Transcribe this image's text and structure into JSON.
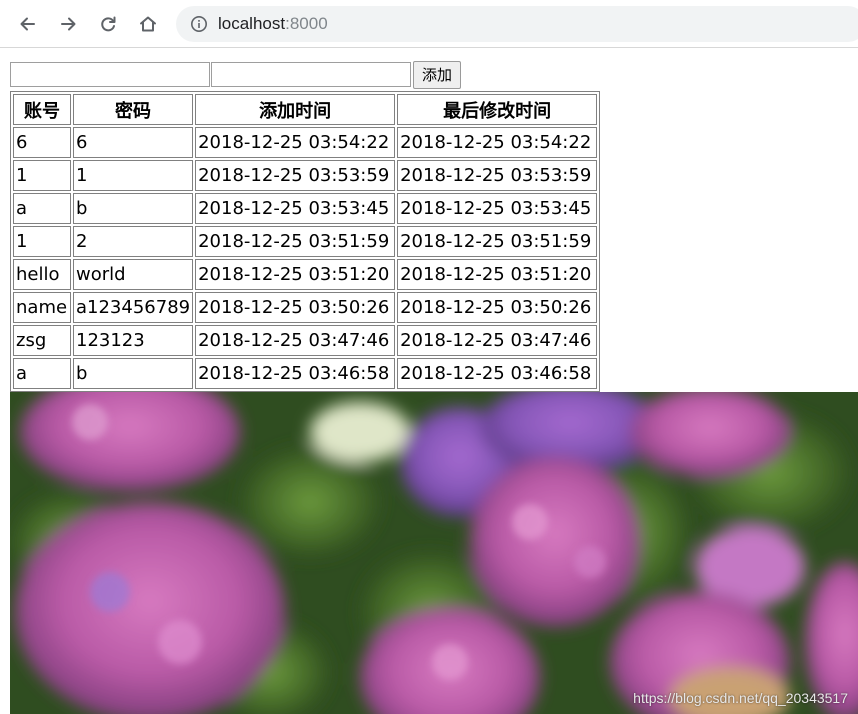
{
  "browser": {
    "url_host": "localhost",
    "url_port": ":8000"
  },
  "form": {
    "add_button": "添加"
  },
  "table": {
    "headers": [
      "账号",
      "密码",
      "添加时间",
      "最后修改时间"
    ],
    "rows": [
      [
        "6",
        "6",
        "2018-12-25 03:54:22",
        "2018-12-25 03:54:22"
      ],
      [
        "1",
        "1",
        "2018-12-25 03:53:59",
        "2018-12-25 03:53:59"
      ],
      [
        "a",
        "b",
        "2018-12-25 03:53:45",
        "2018-12-25 03:53:45"
      ],
      [
        "1",
        "2",
        "2018-12-25 03:51:59",
        "2018-12-25 03:51:59"
      ],
      [
        "hello",
        "world",
        "2018-12-25 03:51:20",
        "2018-12-25 03:51:20"
      ],
      [
        "name",
        "a123456789",
        "2018-12-25 03:50:26",
        "2018-12-25 03:50:26"
      ],
      [
        "zsg",
        "123123",
        "2018-12-25 03:47:46",
        "2018-12-25 03:47:46"
      ],
      [
        "a",
        "b",
        "2018-12-25 03:46:58",
        "2018-12-25 03:46:58"
      ]
    ]
  },
  "image": {
    "watermark": "https://blog.csdn.net/qq_20343517"
  }
}
